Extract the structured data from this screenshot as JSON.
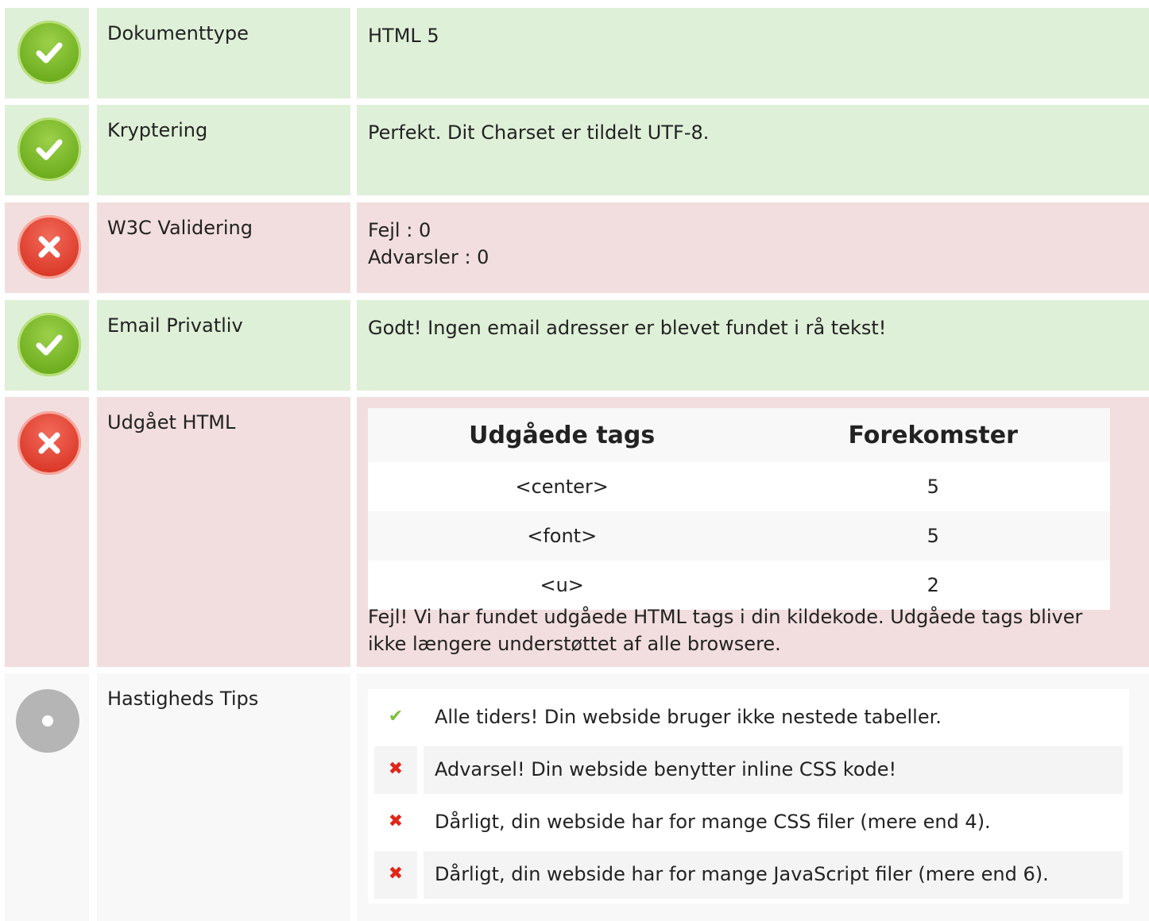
{
  "rows": [
    {
      "status": "ok",
      "icon": "check-circle-icon",
      "label": "Dokumenttype",
      "value": "HTML 5"
    },
    {
      "status": "ok",
      "icon": "check-circle-icon",
      "label": "Kryptering",
      "value": "Perfekt. Dit Charset er tildelt UTF-8."
    },
    {
      "status": "bad",
      "icon": "x-circle-icon",
      "label": "W3C Validering",
      "lines": [
        "Fejl : 0",
        "Advarsler : 0"
      ]
    },
    {
      "status": "ok",
      "icon": "check-circle-icon",
      "label": "Email Privatliv",
      "value": "Godt! Ingen email adresser er blevet fundet i rå tekst!"
    }
  ],
  "deprecated": {
    "status": "bad",
    "icon": "x-circle-icon",
    "label": "Udgået HTML",
    "headers": [
      "Udgåede tags",
      "Forekomster"
    ],
    "rows": [
      [
        "<center>",
        "5"
      ],
      [
        "<font>",
        "5"
      ],
      [
        "<u>",
        "2"
      ]
    ],
    "note": "Fejl! Vi har fundet udgåede HTML tags i din kildekode. Udgåede tags bliver ikke længere understøttet af alle browsere."
  },
  "speed": {
    "status": "info",
    "icon": "info-circle-icon",
    "label": "Hastigheds Tips",
    "tips": [
      {
        "mark": "check-icon",
        "glyph": "✔",
        "kind": "good",
        "text": "Alle tiders! Din webside bruger ikke nestede tabeller."
      },
      {
        "mark": "cross-icon",
        "glyph": "✖",
        "kind": "bad",
        "text": "Advarsel! Din webside benytter inline CSS kode!"
      },
      {
        "mark": "cross-icon",
        "glyph": "✖",
        "kind": "bad",
        "text": "Dårligt, din webside har for mange CSS filer (mere end 4)."
      },
      {
        "mark": "cross-icon",
        "glyph": "✖",
        "kind": "bad",
        "text": "Dårligt, din webside har for mange JavaScript filer (mere end 6)."
      }
    ]
  },
  "colors": {
    "ok_bg": "#dff0d8",
    "bad_bg": "#f2dede",
    "info_bg": "#f8f8f8",
    "check": "#7cbf3a",
    "cross": "#e02618"
  }
}
